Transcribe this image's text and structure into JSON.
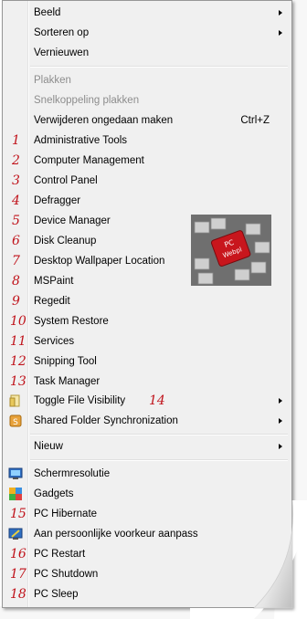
{
  "menu": {
    "top_items": [
      {
        "label": "Beeld",
        "submenu": true
      },
      {
        "label": "Sorteren op",
        "submenu": true
      },
      {
        "label": "Vernieuwen",
        "submenu": false
      }
    ],
    "edit_items": [
      {
        "label": "Plakken",
        "disabled": true
      },
      {
        "label": "Snelkoppeling plakken",
        "disabled": true
      },
      {
        "label": "Verwijderen ongedaan maken",
        "shortcut": "Ctrl+Z",
        "disabled": false
      }
    ],
    "tools": [
      {
        "num": "1",
        "label": "Administrative Tools"
      },
      {
        "num": "2",
        "label": "Computer Management"
      },
      {
        "num": "3",
        "label": "Control Panel"
      },
      {
        "num": "4",
        "label": "Defragger"
      },
      {
        "num": "5",
        "label": "Device Manager"
      },
      {
        "num": "6",
        "label": "Disk Cleanup"
      },
      {
        "num": "7",
        "label": "Desktop Wallpaper Location"
      },
      {
        "num": "8",
        "label": "MSPaint"
      },
      {
        "num": "9",
        "label": "Regedit"
      },
      {
        "num": "10",
        "label": "System Restore"
      },
      {
        "num": "11",
        "label": "Services"
      },
      {
        "num": "12",
        "label": "Snipping Tool"
      },
      {
        "num": "13",
        "label": "Task Manager"
      }
    ],
    "toggle": {
      "label": "Toggle File Visibility",
      "num": "14",
      "icon": "file-visibility-icon"
    },
    "shared": {
      "label": "Shared Folder Synchronization",
      "icon": "sync-folder-icon"
    },
    "nieuw": {
      "label": "Nieuw"
    },
    "bottom": [
      {
        "num": "",
        "label": "Schermresolutie",
        "icon": "monitor-icon"
      },
      {
        "num": "",
        "label": "Gadgets",
        "icon": "gadgets-icon"
      },
      {
        "num": "15",
        "label": "PC Hibernate"
      },
      {
        "num": "",
        "label": "Aan persoonlijke voorkeur aanpass",
        "icon": "personalize-icon"
      },
      {
        "num": "16",
        "label": "PC Restart"
      },
      {
        "num": "17",
        "label": "PC Shutdown"
      },
      {
        "num": "18",
        "label": "PC Sleep"
      }
    ],
    "image": {
      "key_text_line1": "PC",
      "key_text_line2": "Webpl"
    }
  },
  "colors": {
    "number": "#c0131b",
    "menu_bg": "#f0f0f0",
    "disabled": "#8d8d8d"
  }
}
